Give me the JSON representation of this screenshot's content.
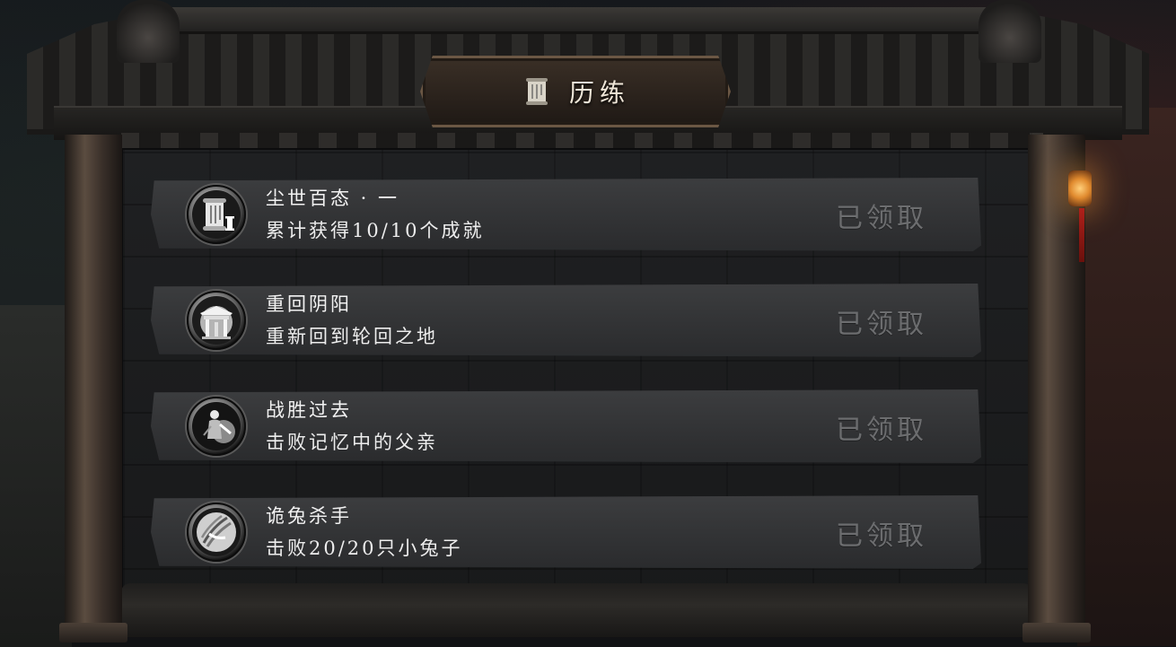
{
  "header": {
    "title": "历练",
    "icon": "scroll-icon"
  },
  "achievements": [
    {
      "title": "尘世百态 · 一",
      "desc": "累计获得10/10个成就",
      "status": "已领取",
      "badge_icon": "scroll-tier-i-icon"
    },
    {
      "title": "重回阴阳",
      "desc": "重新回到轮回之地",
      "status": "已领取",
      "badge_icon": "gate-icon"
    },
    {
      "title": "战胜过去",
      "desc": "击败记忆中的父亲",
      "status": "已领取",
      "badge_icon": "warrior-icon"
    },
    {
      "title": "诡兔杀手",
      "desc": "击败20/20只小兔子",
      "status": "已领取",
      "badge_icon": "claw-slash-icon"
    }
  ],
  "colors": {
    "title_text": "#efe6d8",
    "row_text": "#f2f2f2",
    "claimed_text": "#6c6d6f",
    "lantern": "#e08a2e"
  }
}
